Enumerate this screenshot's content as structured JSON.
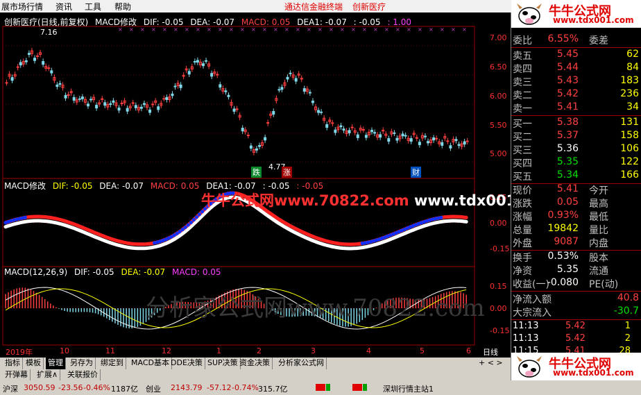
{
  "menu": {
    "items": [
      "展市场行情",
      "资讯",
      "工具",
      "帮助"
    ],
    "links": [
      "通达信金融终端",
      "创新医疗"
    ]
  },
  "main_chart": {
    "title": "创新医疗(日线,前复权)",
    "indicator": "MACD修改",
    "dif": "DIF: -0.05",
    "dea": "DEA: -0.07",
    "macd": "MACD: 0.05",
    "dea1": "DEA1: -0.07",
    "extra": ": -0.05",
    "extra2": ": 1.00",
    "high_label": "7.16",
    "low_label": "4.77",
    "markers": [
      "跌",
      "涨",
      "财"
    ],
    "y_ticks": [
      "7.00",
      "6.50",
      "6.00",
      "5.50",
      "5.00"
    ]
  },
  "macd_mod_panel": {
    "title": "MACD修改",
    "dif": "DIF: -0.05",
    "dea": "DEA: -0.07",
    "macd": "MACD: 0.05",
    "dea1": "DEA1: -0.07",
    "extra": ": -0.05",
    "extra2": ": -0.05",
    "y_ticks": [
      "0.15",
      "0.00",
      "-0.15"
    ],
    "watermark_a": "牛牛公式网",
    "watermark_b": "www.70822.com",
    "watermark_c": "www.tdx001.com"
  },
  "macd_panel": {
    "title": "MACD(12,26,9)",
    "dif": "DIF: -0.05",
    "dea": "DEA: -0.07",
    "macd": "MACD: 0.05",
    "y_ticks": [
      "0.15",
      "0.00",
      "-0.15"
    ],
    "watermark": "分析家公式网www.70822.com"
  },
  "x_axis": {
    "labels": [
      "2019年",
      "10",
      "11",
      "12",
      "1",
      "2",
      "3",
      "4",
      "5",
      "6"
    ],
    "period": "日线"
  },
  "tabs": [
    "指标",
    "模板",
    "管理",
    "另存为",
    "绑定到",
    "MACD基本",
    "DDE决策",
    "SUP决策",
    "资金决策",
    "分析家公式网"
  ],
  "tabs_active": "管理",
  "tabs2": [
    "开弹幕",
    "扩展∧",
    "关联报价"
  ],
  "status": {
    "items": [
      "沪深",
      "3050.59",
      "-23.56",
      "-0.46%",
      "1187亿",
      "创业",
      "2143.79",
      "-57.12",
      "-0.74%",
      "315.7亿",
      "深圳行情主站1"
    ]
  },
  "quote_panel": {
    "logo_title": "牛牛公式网",
    "logo_url": "www.tdx001.com",
    "weibi_label": "委比",
    "weibi_value": "6.55%",
    "weicha_label": "委差",
    "weicha_value": "",
    "asks": [
      {
        "label": "卖五",
        "price": "5.45",
        "vol": "62"
      },
      {
        "label": "卖四",
        "price": "5.44",
        "vol": "84"
      },
      {
        "label": "卖三",
        "price": "5.43",
        "vol": "183"
      },
      {
        "label": "卖二",
        "price": "5.42",
        "vol": "236"
      },
      {
        "label": "卖一",
        "price": "5.41",
        "vol": "34"
      }
    ],
    "bids": [
      {
        "label": "买一",
        "price": "5.38",
        "vol": "131"
      },
      {
        "label": "买二",
        "price": "5.37",
        "vol": "158"
      },
      {
        "label": "买三",
        "price": "5.36",
        "vol": "106"
      },
      {
        "label": "买四",
        "price": "5.35",
        "vol": "122"
      },
      {
        "label": "买五",
        "price": "5.34",
        "vol": "166"
      }
    ],
    "stats": [
      {
        "l1": "现价",
        "v1": "5.41",
        "l2": "今开",
        "v2": ""
      },
      {
        "l1": "涨跌",
        "v1": "0.05",
        "l2": "最高",
        "v2": ""
      },
      {
        "l1": "涨幅",
        "v1": "0.93%",
        "l2": "最低",
        "v2": ""
      },
      {
        "l1": "总量",
        "v1": "19842",
        "l2": "量比",
        "v2": ""
      },
      {
        "l1": "外盘",
        "v1": "9087",
        "l2": "内盘",
        "v2": ""
      }
    ],
    "stats2": [
      {
        "l1": "换手",
        "v1": "0.53%",
        "l2": "股本"
      },
      {
        "l1": "净资",
        "v1": "5.35",
        "l2": "流通"
      },
      {
        "l1": "收益(一)",
        "v1": "-0.080",
        "l2": "PE(动)"
      }
    ],
    "flow": [
      {
        "label": "净流入额",
        "value": "40.8"
      },
      {
        "label": "大宗流入",
        "value": "-30.7"
      }
    ],
    "ticks": [
      {
        "time": "11:13",
        "price": "5.42",
        "vol": "1"
      },
      {
        "time": "11:13",
        "price": "5.42",
        "vol": "2"
      },
      {
        "time": "11:15",
        "price": "5.41",
        "vol": "28"
      }
    ]
  }
}
